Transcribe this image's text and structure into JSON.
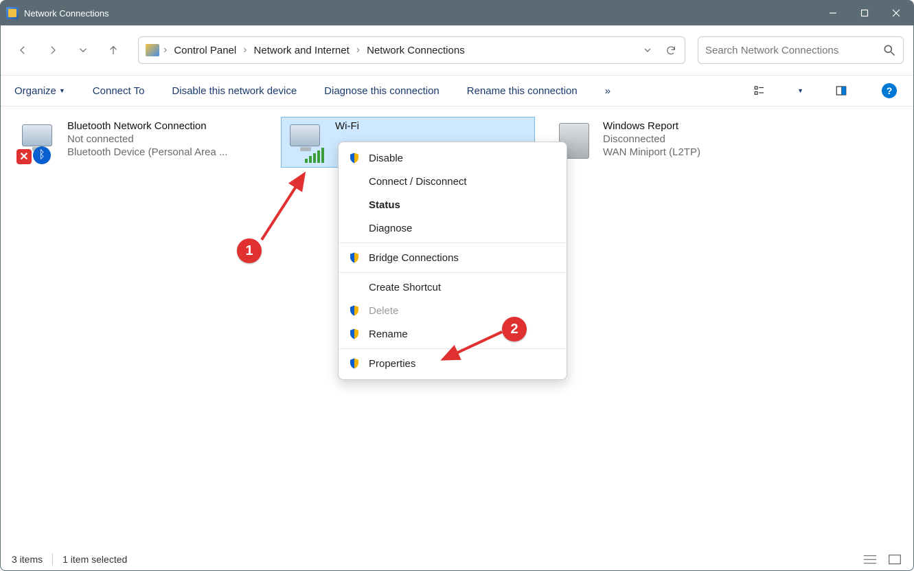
{
  "window": {
    "title": "Network Connections"
  },
  "breadcrumb": [
    "Control Panel",
    "Network and Internet",
    "Network Connections"
  ],
  "search": {
    "placeholder": "Search Network Connections"
  },
  "cmdbar": {
    "organize": "Organize",
    "connect": "Connect To",
    "disable": "Disable this network device",
    "diagnose": "Diagnose this connection",
    "rename": "Rename this connection",
    "more": "»"
  },
  "items": [
    {
      "name": "Bluetooth Network Connection",
      "status": "Not connected",
      "device": "Bluetooth Device (Personal Area ..."
    },
    {
      "name": "Wi-Fi",
      "status": "",
      "device": ""
    },
    {
      "name": "Windows Report",
      "status": "Disconnected",
      "device": "WAN Miniport (L2TP)"
    }
  ],
  "context_menu": {
    "disable": "Disable",
    "connect": "Connect / Disconnect",
    "status": "Status",
    "diagnose": "Diagnose",
    "bridge": "Bridge Connections",
    "shortcut": "Create Shortcut",
    "delete": "Delete",
    "rename": "Rename",
    "properties": "Properties"
  },
  "callouts": {
    "one": "1",
    "two": "2"
  },
  "statusbar": {
    "items": "3 items",
    "selected": "1 item selected"
  }
}
